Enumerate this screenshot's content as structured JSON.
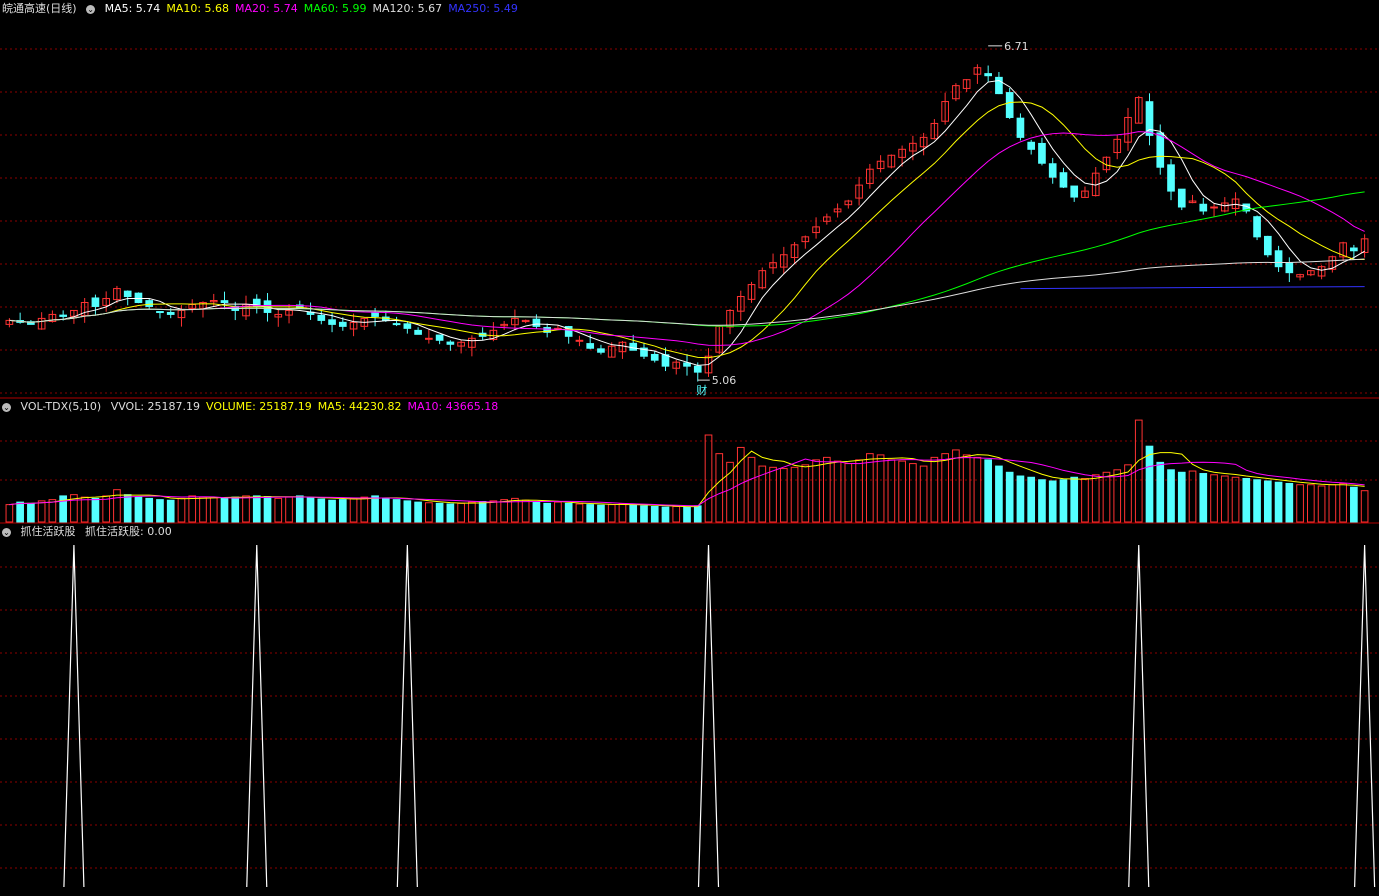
{
  "stock": {
    "name": "皖通高速",
    "period": "(日线)"
  },
  "price_panel": {
    "indicators": [
      {
        "label": "MA5: 5.74",
        "color": "#ffffff"
      },
      {
        "label": "MA10: 5.68",
        "color": "#ffff00"
      },
      {
        "label": "MA20: 5.74",
        "color": "#ff00ff"
      },
      {
        "label": "MA60: 5.99",
        "color": "#00ff00"
      },
      {
        "label": "MA120: 5.67",
        "color": "#dddddd"
      },
      {
        "label": "MA250: 5.49",
        "color": "#3333ff"
      }
    ],
    "high_label": "6.71",
    "low_label": "5.06",
    "event_marker": "财"
  },
  "volume_panel": {
    "title": "VOL-TDX(5,10)",
    "indicators": [
      {
        "label": "VVOL: 25187.19",
        "color": "#dddddd"
      },
      {
        "label": "VOLUME: 25187.19",
        "color": "#ffff00"
      },
      {
        "label": "MA5: 44230.82",
        "color": "#ffff00"
      },
      {
        "label": "MA10: 43665.18",
        "color": "#ff00ff"
      }
    ]
  },
  "signal_panel": {
    "title": "抓住活跃股",
    "value_label": "抓住活跃股: 0.00"
  },
  "colors": {
    "up": "#ff3232",
    "down": "#54ffff",
    "grid": "#8b0000",
    "divider": "#b00000"
  },
  "chart_data": {
    "type": "candlestick",
    "ylim": [
      4.95,
      6.85
    ],
    "closes": [
      5.33,
      5.32,
      5.31,
      5.34,
      5.36,
      5.35,
      5.38,
      5.42,
      5.4,
      5.44,
      5.49,
      5.45,
      5.42,
      5.4,
      5.37,
      5.36,
      5.38,
      5.41,
      5.42,
      5.43,
      5.42,
      5.38,
      5.41,
      5.4,
      5.37,
      5.36,
      5.38,
      5.39,
      5.36,
      5.33,
      5.31,
      5.3,
      5.32,
      5.34,
      5.35,
      5.33,
      5.31,
      5.29,
      5.26,
      5.24,
      5.23,
      5.21,
      5.22,
      5.24,
      5.25,
      5.28,
      5.31,
      5.34,
      5.33,
      5.3,
      5.27,
      5.29,
      5.25,
      5.23,
      5.19,
      5.17,
      5.2,
      5.22,
      5.18,
      5.15,
      5.13,
      5.1,
      5.12,
      5.1,
      5.07,
      5.15,
      5.3,
      5.38,
      5.45,
      5.51,
      5.58,
      5.62,
      5.66,
      5.71,
      5.75,
      5.8,
      5.85,
      5.89,
      5.93,
      6.01,
      6.09,
      6.13,
      6.16,
      6.19,
      6.22,
      6.25,
      6.32,
      6.43,
      6.51,
      6.54,
      6.6,
      6.56,
      6.47,
      6.35,
      6.25,
      6.19,
      6.12,
      6.05,
      6.0,
      5.95,
      5.98,
      6.07,
      6.15,
      6.24,
      6.35,
      6.45,
      6.26,
      6.1,
      5.98,
      5.9,
      5.93,
      5.88,
      5.9,
      5.92,
      5.94,
      5.88,
      5.75,
      5.66,
      5.6,
      5.57,
      5.56,
      5.58,
      5.6,
      5.65,
      5.72,
      5.68,
      5.74
    ],
    "volumes": [
      14000,
      16000,
      15000,
      17000,
      18000,
      21000,
      22000,
      20000,
      19000,
      21000,
      26000,
      22000,
      20000,
      19000,
      18000,
      17500,
      19000,
      21000,
      20000,
      19500,
      19000,
      20000,
      21000,
      21000,
      20500,
      19000,
      20000,
      21000,
      19500,
      18500,
      17500,
      18000,
      19000,
      20000,
      21000,
      19000,
      18000,
      17000,
      16000,
      15500,
      15000,
      14500,
      15000,
      16000,
      16500,
      17000,
      18000,
      19000,
      17500,
      16000,
      15000,
      16000,
      15000,
      14500,
      14000,
      13500,
      14000,
      14500,
      14000,
      13000,
      12500,
      12000,
      12500,
      12000,
      13000,
      70000,
      55000,
      48000,
      60000,
      52000,
      45000,
      44000,
      43000,
      44000,
      46000,
      50000,
      52000,
      49000,
      47000,
      50000,
      55000,
      54000,
      50000,
      49000,
      47000,
      45000,
      52000,
      55000,
      58000,
      54000,
      52000,
      50000,
      45000,
      40000,
      37000,
      36000,
      34000,
      33000,
      34000,
      36000,
      35000,
      38000,
      40000,
      42000,
      46000,
      82000,
      61000,
      48000,
      42000,
      40000,
      41000,
      39000,
      38000,
      37000,
      36000,
      35000,
      34000,
      33000,
      32000,
      31000,
      30000,
      30000,
      29000,
      30000,
      31000,
      28000,
      25187
    ],
    "signals": [
      0,
      0,
      0,
      0,
      0,
      0,
      0,
      0,
      0,
      0,
      0,
      0,
      0,
      0,
      0,
      0,
      0,
      0,
      0,
      0,
      0,
      0,
      0,
      0,
      0,
      0,
      0,
      0,
      0,
      0,
      0,
      0,
      0,
      0,
      0,
      0,
      0,
      0,
      0,
      0,
      0,
      0,
      0,
      0,
      0,
      0,
      0,
      0,
      0,
      0,
      0,
      0,
      0,
      0,
      0,
      0,
      0,
      0,
      0,
      0,
      0,
      0,
      0,
      0,
      0,
      1,
      0,
      0,
      0,
      0,
      0,
      0,
      0,
      0,
      0,
      0,
      0,
      0,
      0,
      0,
      0,
      0,
      0,
      0,
      0,
      0,
      0,
      0,
      0,
      0,
      0,
      0,
      0,
      0,
      0,
      0,
      0,
      0,
      0,
      0,
      0,
      0,
      0,
      0,
      0,
      1,
      0,
      0,
      0,
      0,
      0,
      0,
      0,
      0,
      0,
      0,
      0,
      0,
      0,
      0,
      0,
      0,
      0,
      0,
      0,
      0,
      0
    ],
    "extra_signal_bars": [
      6,
      23,
      37
    ]
  }
}
